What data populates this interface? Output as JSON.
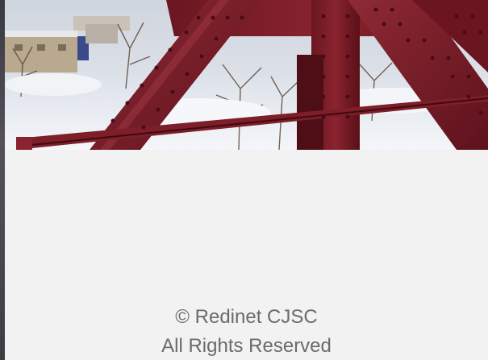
{
  "hero": {
    "image": "bridge-truss-photo",
    "colors": {
      "steel": "#7a1f2a",
      "steel_dark": "#5a1019",
      "snow": "#eef0f4",
      "sky": "#dfe3ea"
    }
  },
  "footer": {
    "copyright": "© Redinet CJSC",
    "rights": "All Rights Reserved"
  },
  "colors": {
    "background": "#f2f2f2",
    "footer_text": "#6b6b6b"
  }
}
